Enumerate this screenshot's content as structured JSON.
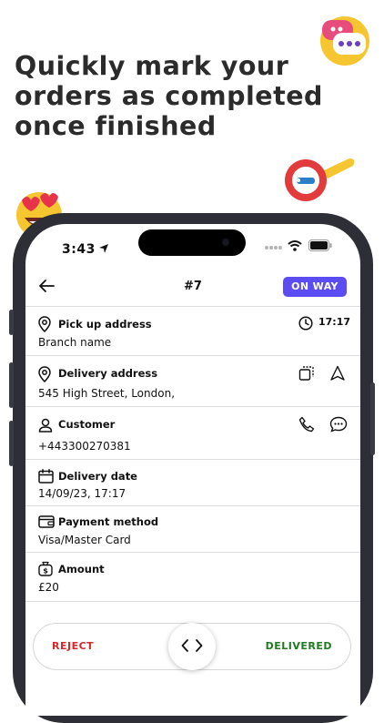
{
  "headline": "Quickly mark your\norders as completed\nonce finished",
  "icons": {
    "chat_emoji": "speech-bubble-emoji",
    "search_emoji": "magnifier-emoji",
    "heart_emoji": "heart-eyes-emoji"
  },
  "status_bar": {
    "time": "3:43"
  },
  "order": {
    "number": "#7",
    "status": "ON WAY",
    "status_color": "#5b4df3"
  },
  "rows": {
    "pickup": {
      "label": "Pick up address",
      "value": "Branch name",
      "time": "17:17"
    },
    "delivery": {
      "label": "Delivery address",
      "value": "545 High Street, London,"
    },
    "customer": {
      "label": "Customer",
      "value": "+443300270381"
    },
    "date": {
      "label": "Delivery date",
      "value": "14/09/23, 17:17"
    },
    "payment": {
      "label": "Payment method",
      "value": "Visa/Master Card"
    },
    "amount": {
      "label": "Amount",
      "value": "£20"
    }
  },
  "actions": {
    "reject": "REJECT",
    "delivered": "DELIVERED",
    "reject_color": "#d9262d",
    "delivered_color": "#1e7b1e"
  }
}
